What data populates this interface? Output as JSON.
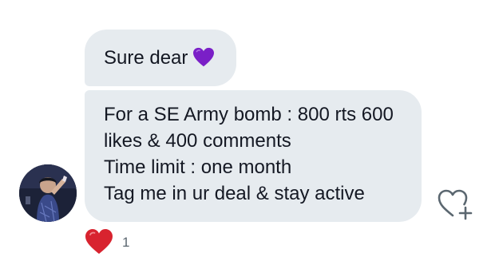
{
  "messages": [
    {
      "text": "Sure dear",
      "emoji": "purple-heart"
    },
    {
      "lines": [
        "For a SE Army bomb : 800 rts 600",
        "likes & 400 comments",
        "Time limit : one month",
        "Tag me in ur deal & stay active"
      ]
    }
  ],
  "reaction": {
    "emoji": "red-heart",
    "count": "1"
  },
  "colors": {
    "bubble": "#e6ebef",
    "text": "#141823",
    "purple_heart": "#7a1fc7",
    "red_heart": "#d8232f",
    "muted": "#5b6770"
  }
}
